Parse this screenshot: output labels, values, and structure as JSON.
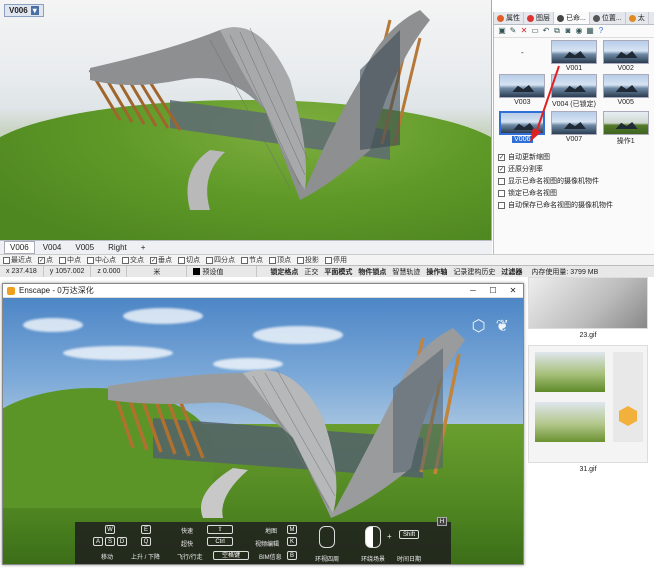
{
  "rhino": {
    "viewport_label": "V006",
    "viewport_tabs": [
      "V006",
      "V004",
      "V005",
      "Right"
    ],
    "add_tab": "+"
  },
  "osnap": {
    "items": [
      {
        "label": "最近点",
        "checked": false
      },
      {
        "label": "点",
        "checked": true
      },
      {
        "label": "中点",
        "checked": false
      },
      {
        "label": "中心点",
        "checked": false
      },
      {
        "label": "交点",
        "checked": false
      },
      {
        "label": "垂点",
        "checked": true
      },
      {
        "label": "切点",
        "checked": false
      },
      {
        "label": "四分点",
        "checked": false
      },
      {
        "label": "节点",
        "checked": false
      },
      {
        "label": "顶点",
        "checked": false
      },
      {
        "label": "投影",
        "checked": false
      },
      {
        "label": "停用",
        "checked": false
      }
    ]
  },
  "status": {
    "x": "x 237.418",
    "y": "y 1057.002",
    "z": "z 0.000",
    "unit": "米",
    "layer": "预设值",
    "buttons": [
      "锁定格点",
      "正交",
      "平面模式",
      "物件锁点",
      "智慧轨迹",
      "操作轴",
      "记录建构历史",
      "过滤器"
    ],
    "memory": "内存使用量: 3799 MB"
  },
  "panel": {
    "tabs": [
      "属性",
      "图层",
      "已命...",
      "位置...",
      "太"
    ],
    "thumbs": [
      {
        "label": "",
        "type": "blank"
      },
      {
        "label": "V001",
        "type": "blue"
      },
      {
        "label": "V002",
        "type": "blue"
      },
      {
        "label": "V003",
        "type": "blue"
      },
      {
        "label": "V004 (已锁定)",
        "type": "blue"
      },
      {
        "label": "V005",
        "type": "blue"
      },
      {
        "label": "V006",
        "type": "selected"
      },
      {
        "label": "V007",
        "type": "blue"
      },
      {
        "label": "操作1",
        "type": "green"
      }
    ],
    "thumb_above_blank": "-",
    "options": [
      {
        "label": "自动更新缩图",
        "checked": true
      },
      {
        "label": "还原分割率",
        "checked": true
      },
      {
        "label": "显示已命名视图的摄像机物件",
        "checked": false
      },
      {
        "label": "锁定已命名视图",
        "checked": false
      },
      {
        "label": "自动保存已命名视图的摄像机物件",
        "checked": false
      }
    ]
  },
  "files": {
    "captions": [
      "23.gif",
      "31.gif"
    ]
  },
  "enscape": {
    "title": "Enscape - 0万达深化",
    "help": {
      "badge": "H",
      "keys_move": [
        "W",
        "A",
        "S",
        "D"
      ],
      "keys_updown": [
        "E",
        "Q"
      ],
      "move_label": "移动",
      "updown_label": "上升 / 下降",
      "fast_label": "快速",
      "slow_label": "超快",
      "fly_label": "飞行/行走",
      "ctrl_key": "Ctrl",
      "space_key": "空格键",
      "map_label": "地图",
      "map_key": "M",
      "video_label": "视频编辑",
      "video_key": "K",
      "bim_label": "BIM信息",
      "bim_key": "B",
      "look_label": "环视四周",
      "rotate_label": "环绕场景",
      "shift_key": "Shift",
      "plus": "+",
      "time_label": "时间日期"
    }
  },
  "colors": {
    "accent": "#2f6fd6",
    "arrow": "#e02020"
  }
}
